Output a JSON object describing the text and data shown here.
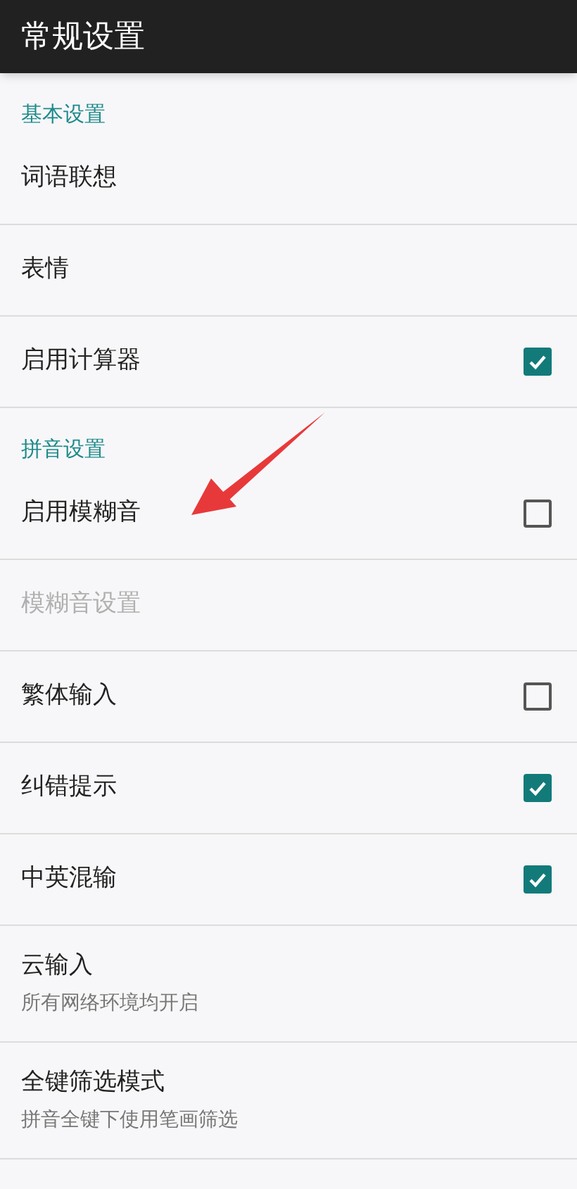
{
  "app_bar": {
    "title": "常规设置"
  },
  "sections": [
    {
      "title": "基本设置",
      "items": [
        {
          "kind": "plain",
          "label": "词语联想",
          "disabled": false
        },
        {
          "kind": "plain",
          "label": "表情",
          "disabled": false
        },
        {
          "kind": "checkbox",
          "label": "启用计算器",
          "checked": true,
          "disabled": false
        }
      ]
    },
    {
      "title": "拼音设置",
      "items": [
        {
          "kind": "checkbox",
          "label": "启用模糊音",
          "checked": false,
          "disabled": false
        },
        {
          "kind": "plain",
          "label": "模糊音设置",
          "disabled": true
        },
        {
          "kind": "checkbox",
          "label": "繁体输入",
          "checked": false,
          "disabled": false
        },
        {
          "kind": "checkbox",
          "label": "纠错提示",
          "checked": true,
          "disabled": false
        },
        {
          "kind": "checkbox",
          "label": "中英混输",
          "checked": true,
          "disabled": false
        },
        {
          "kind": "plain",
          "label": "云输入",
          "summary": "所有网络环境均开启",
          "disabled": false
        },
        {
          "kind": "plain",
          "label": "全键筛选模式",
          "summary": "拼音全键下使用笔画筛选",
          "disabled": false
        }
      ]
    }
  ]
}
